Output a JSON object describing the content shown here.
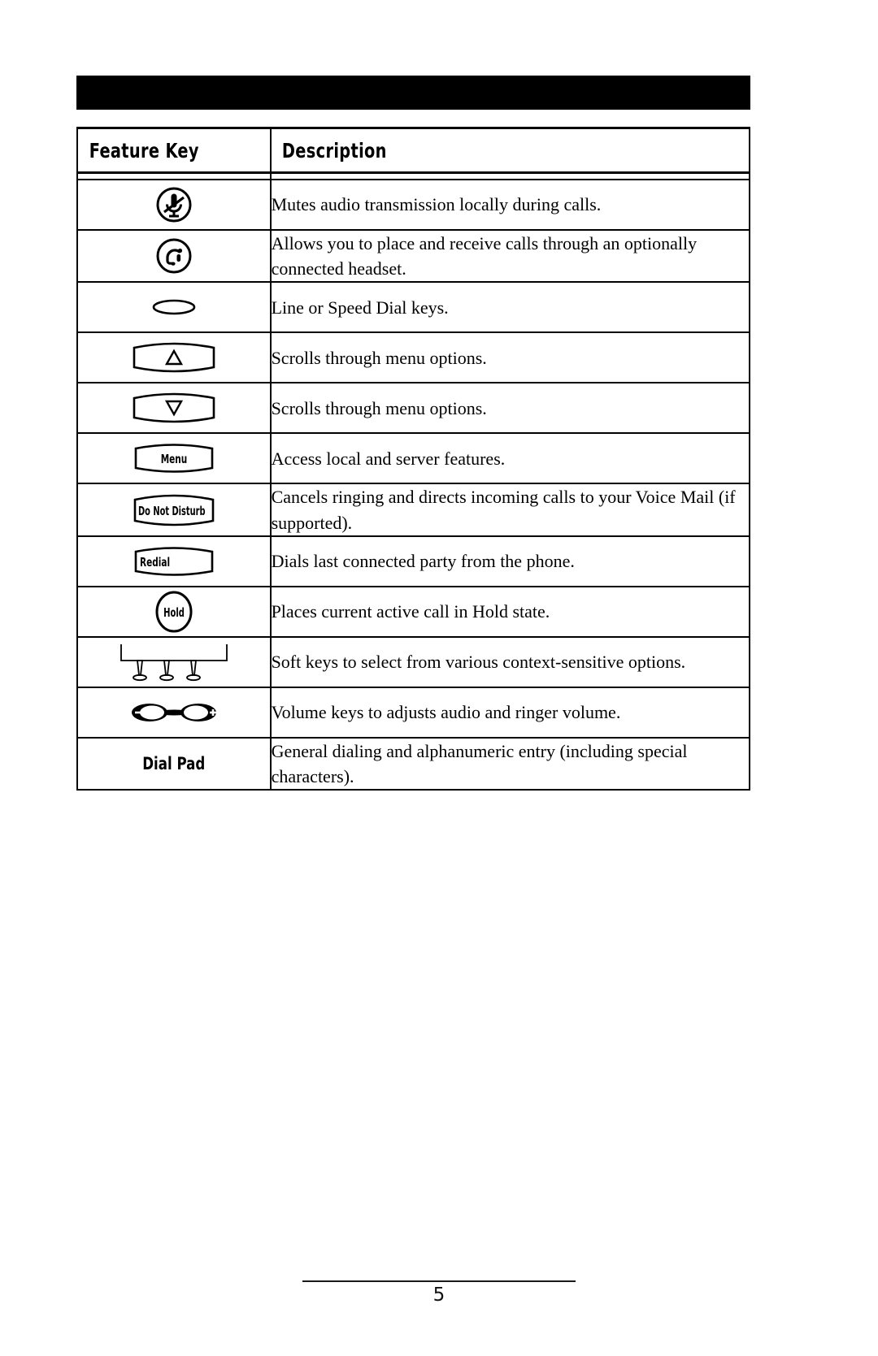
{
  "page": {
    "number": "5",
    "header_bar": {
      "label": ""
    }
  },
  "table": {
    "headers": {
      "feature_key": "Feature Key",
      "description": "Description"
    },
    "rows": [
      {
        "icon": "mute-icon",
        "key_label": "",
        "description": "Mutes audio transmission locally during calls."
      },
      {
        "icon": "headset-icon",
        "key_label": "",
        "description": "Allows you to place and receive calls through an optionally connected headset."
      },
      {
        "icon": "line-key-icon",
        "key_label": "",
        "description": "Line or Speed Dial keys."
      },
      {
        "icon": "scroll-up-key-icon",
        "key_label": "",
        "description": "Scrolls through menu options."
      },
      {
        "icon": "scroll-down-key-icon",
        "key_label": "",
        "description": "Scrolls through menu options."
      },
      {
        "icon": "menu-key-icon",
        "key_label": "Menu",
        "description": "Access local and server features."
      },
      {
        "icon": "do-not-disturb-key-icon",
        "key_label": "Do Not Disturb",
        "description": "Cancels ringing and directs incoming calls to your Voice Mail (if supported)."
      },
      {
        "icon": "redial-key-icon",
        "key_label": "Redial",
        "description": "Dials last connected party from the phone."
      },
      {
        "icon": "hold-key-icon",
        "key_label": "Hold",
        "description": "Places current active call in Hold state."
      },
      {
        "icon": "soft-keys-icon",
        "key_label": "",
        "description": "Soft keys to select from various context-sensitive options."
      },
      {
        "icon": "volume-keys-icon",
        "key_label": "",
        "description": "Volume keys to adjusts audio and ringer volume."
      },
      {
        "icon": "",
        "key_label": "Dial Pad",
        "description": "General dialing and alphanumeric entry (including special characters)."
      }
    ]
  },
  "colors": {
    "ink": "#000000",
    "paper": "#ffffff",
    "header_bar": "#000000"
  }
}
